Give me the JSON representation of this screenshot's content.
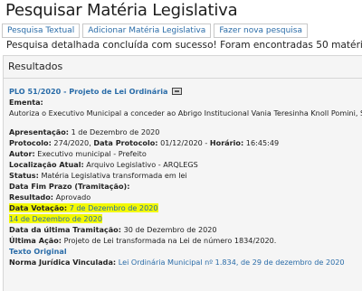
{
  "page": {
    "title": "Pesquisar Matéria Legislativa"
  },
  "tabs": [
    {
      "label": "Pesquisa Textual"
    },
    {
      "label": "Adicionar Matéria Legislativa"
    },
    {
      "label": "Fazer nova pesquisa"
    }
  ],
  "message": "Pesquisa detalhada concluída com sucesso! Foram encontradas 50 matérias.",
  "results": {
    "header": "Resultados",
    "item": {
      "title_link": "PLO 51/2020 - Projeto de Lei Ordinária",
      "icon": "document-icon",
      "ementa_label": "Ementa:",
      "ementa_text": "Autoriza o Executivo Municipal a conceder ao Abrigo Institucional Vania Teresinha Knoll Pomini, Subv",
      "apresentacao_label": "Apresentação:",
      "apresentacao_value": "1 de Dezembro de 2020",
      "protocolo_label": "Protocolo:",
      "protocolo_value": "274/2020,",
      "data_protocolo_label": "Data Protocolo:",
      "data_protocolo_value": "01/12/2020",
      "horario_sep": "-",
      "horario_label": "Horário:",
      "horario_value": "16:45:49",
      "autor_label": "Autor:",
      "autor_value": "Executivo municipal - Prefeito",
      "localizacao_label": "Localização Atual:",
      "localizacao_value": "Arquivo Legislativo - ARQLEGS",
      "status_label": "Status:",
      "status_value": "Matéria Legislativa transformada em lei",
      "data_fim_prazo_label": "Data Fim Prazo (Tramitação):",
      "resultado_label": "Resultado:",
      "resultado_value": "Aprovado",
      "data_votacao_label": "Data Votação:",
      "data_votacao_value": "7 de Dezembro de 2020",
      "data_votacao_value2": "14 de Dezembro de 2020",
      "data_ultima_tramitacao_label": "Data da última Tramitação:",
      "data_ultima_tramitacao_value": "30 de Dezembro de 2020",
      "ultima_acao_label": "Última Ação:",
      "ultima_acao_value": "Projeto de Lei transformada na Lei de número 1834/2020.",
      "texto_original_link": "Texto Original",
      "norma_label": "Norma Jurídica Vinculada:",
      "norma_value": "Lei Ordinária Municipal nº 1.834, de 29 de dezembro de 2020"
    }
  },
  "colors": {
    "link": "#2a6ca8",
    "highlight": "#f3f900",
    "panel_bg": "#f5f5f5"
  }
}
